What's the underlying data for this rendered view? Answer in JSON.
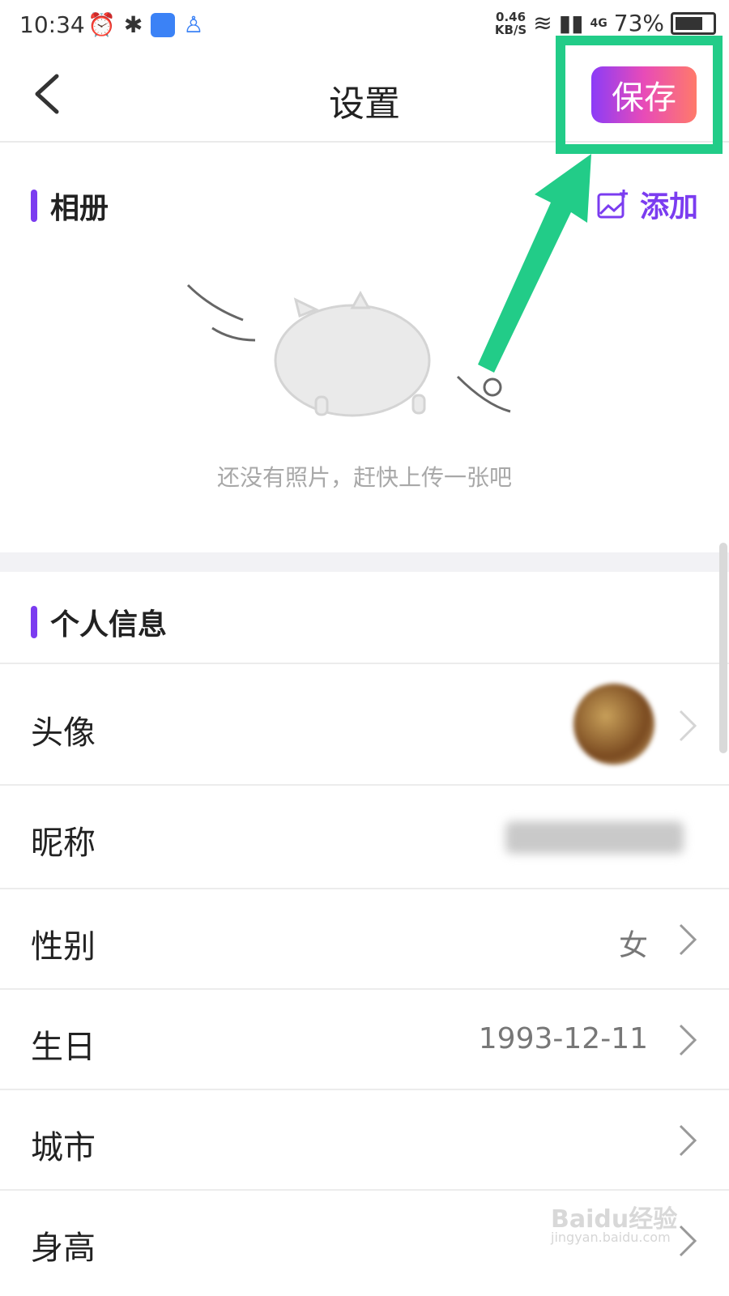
{
  "status_bar": {
    "time": "10:34",
    "speed_value": "0.46",
    "speed_unit": "KB/S",
    "network": "4G",
    "battery": "73%"
  },
  "nav": {
    "title": "设置",
    "save_label": "保存"
  },
  "album": {
    "title": "相册",
    "add_label": "添加",
    "empty_text": "还没有照片，赶快上传一张吧"
  },
  "personal": {
    "title": "个人信息",
    "rows": [
      {
        "label": "头像",
        "value": ""
      },
      {
        "label": "昵称",
        "value": ""
      },
      {
        "label": "性别",
        "value": "女"
      },
      {
        "label": "生日",
        "value": "1993-12-11"
      },
      {
        "label": "城市",
        "value": ""
      },
      {
        "label": "身高",
        "value": ""
      }
    ]
  },
  "colors": {
    "accent": "#7b3cf0",
    "highlight": "#22cc88"
  },
  "watermark": {
    "brand": "Baidu经验",
    "url": "jingyan.baidu.com"
  }
}
